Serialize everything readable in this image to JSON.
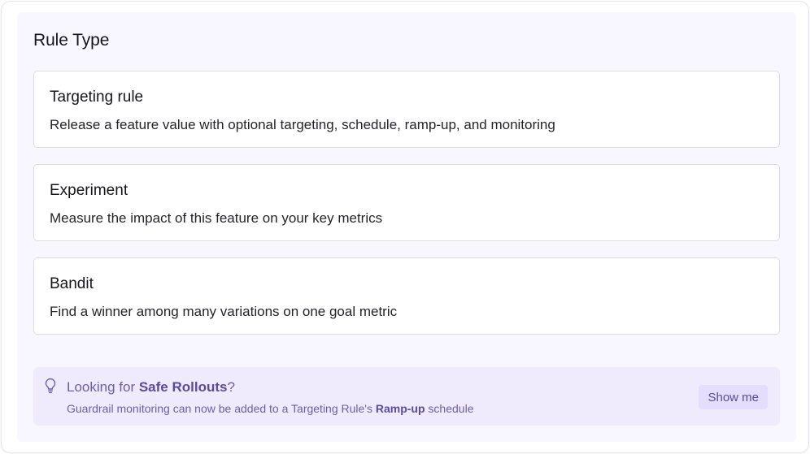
{
  "panel": {
    "title": "Rule Type"
  },
  "options": [
    {
      "title": "Targeting rule",
      "description": "Release a feature value with optional targeting, schedule, ramp-up, and monitoring"
    },
    {
      "title": "Experiment",
      "description": "Measure the impact of this feature on your key metrics"
    },
    {
      "title": "Bandit",
      "description": "Find a winner among many variations on one goal metric"
    }
  ],
  "callout": {
    "icon": "lightbulb-icon",
    "headline_prefix": "Looking for ",
    "headline_emphasis": "Safe Rollouts",
    "headline_suffix": "?",
    "subline_prefix": "Guardrail monitoring can now be added to a Targeting Rule's ",
    "subline_emphasis": "Ramp-up",
    "subline_suffix": " schedule",
    "button_label": "Show me"
  },
  "colors": {
    "panel_background": "#f8f7ff",
    "callout_background": "#efebfd",
    "accent": "#5b4b9e"
  }
}
